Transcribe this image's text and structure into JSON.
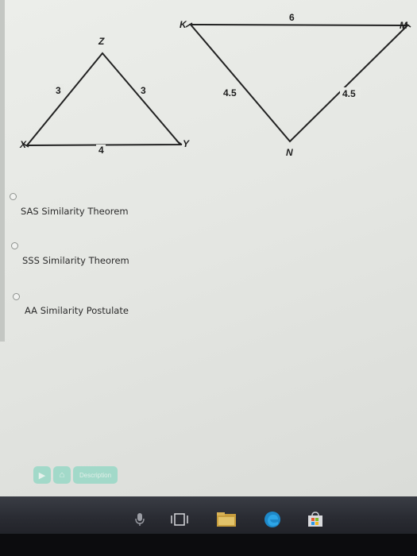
{
  "triangles": {
    "left": {
      "vertices": {
        "x": "X",
        "y": "Y",
        "z": "Z"
      },
      "sides": {
        "xz": "3",
        "zy": "3",
        "xy": "4"
      }
    },
    "right": {
      "vertices": {
        "k": "K",
        "m": "M",
        "n": "N"
      },
      "sides": {
        "km": "6",
        "kn": "4.5",
        "mn": "4.5"
      }
    }
  },
  "options": [
    {
      "label": "SAS Similarity Theorem"
    },
    {
      "label": "SSS Similarity Theorem"
    },
    {
      "label": "AA Similarity Postulate"
    }
  ],
  "toolbar": {
    "description_label": "Description"
  },
  "colors": {
    "button_teal": "#8ed7c3",
    "taskbar": "#2a2c33",
    "edge_blue": "#1e88c8"
  },
  "taskbar_icons": [
    "microphone-icon",
    "task-view-icon",
    "file-explorer-icon",
    "edge-icon",
    "store-icon"
  ]
}
